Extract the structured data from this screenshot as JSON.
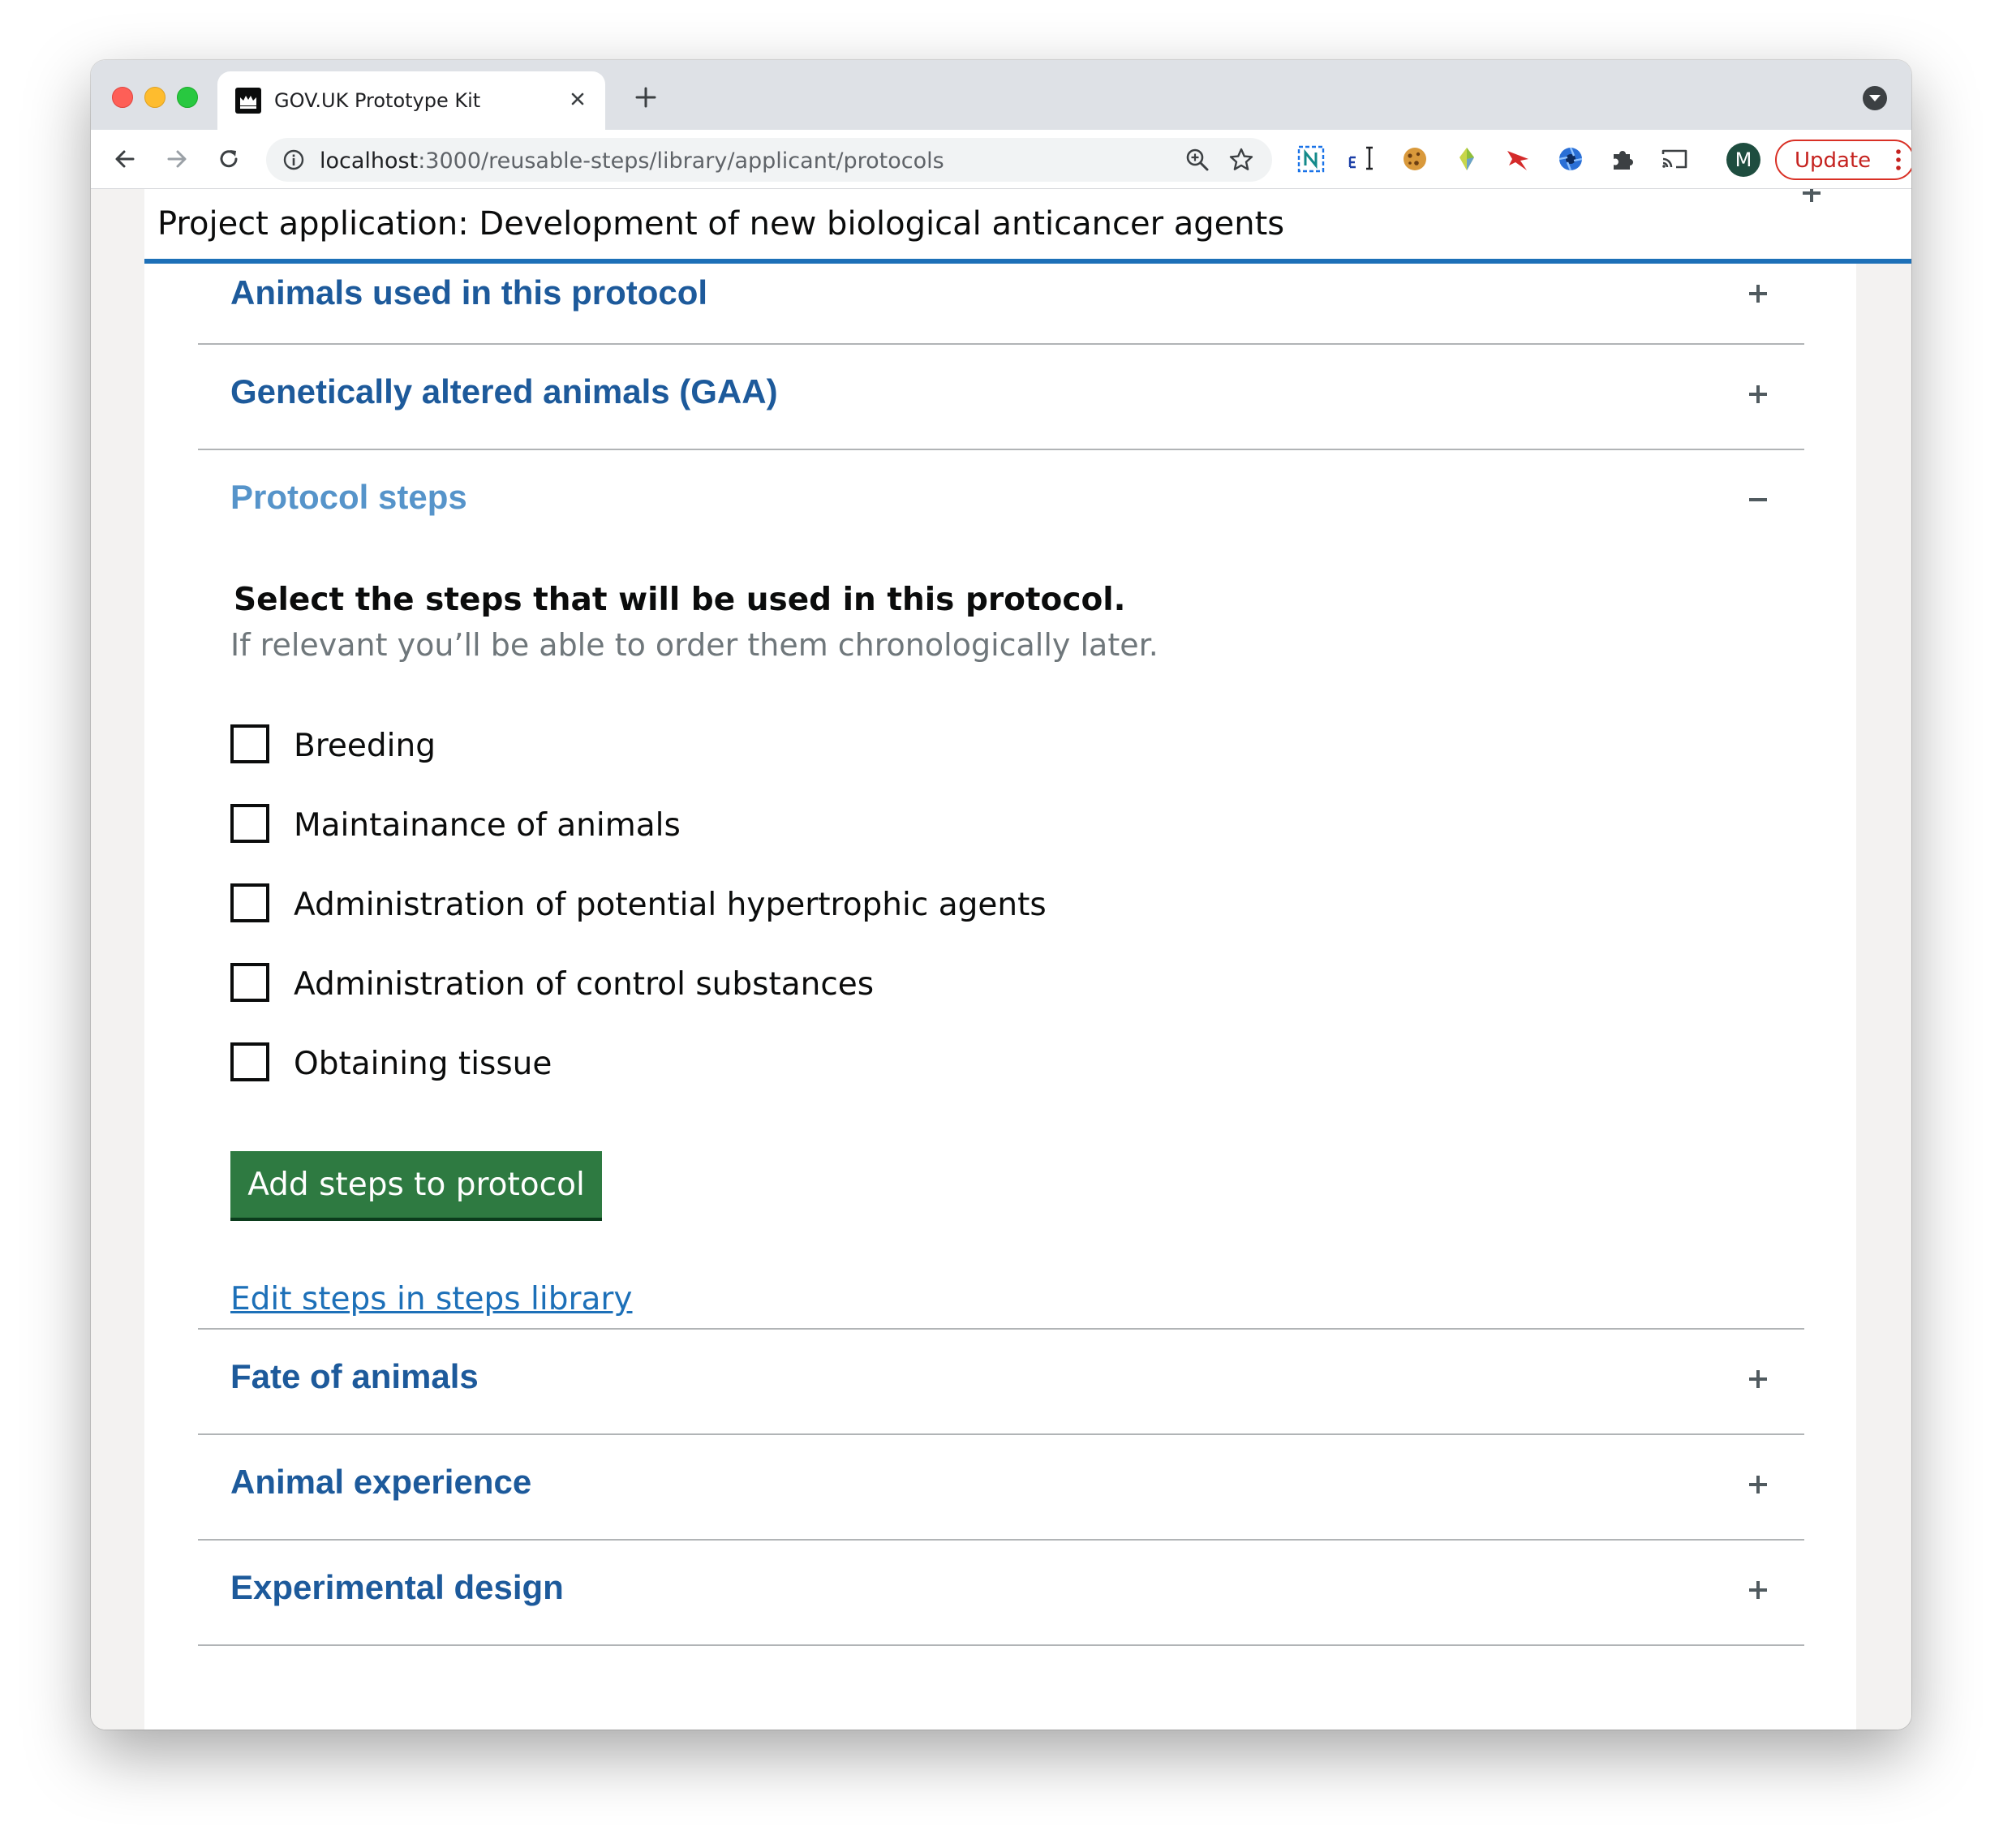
{
  "browser": {
    "tab_title": "GOV.UK Prototype Kit",
    "url_host": "localhost",
    "url_path": ":3000/reusable-steps/library/applicant/protocols",
    "avatar_letter": "M",
    "update_label": "Update"
  },
  "page": {
    "project_title": "Project application: Development of new biological anticancer agents",
    "sections": [
      {
        "heading": "Animals used in this protocol",
        "state": "collapsed"
      },
      {
        "heading": "Genetically altered animals (GAA)",
        "state": "collapsed"
      },
      {
        "heading": "Protocol steps",
        "state": "expanded"
      },
      {
        "heading": "Fate of animals",
        "state": "collapsed"
      },
      {
        "heading": "Animal experience",
        "state": "collapsed"
      },
      {
        "heading": "Experimental design",
        "state": "collapsed"
      }
    ],
    "protocol_steps": {
      "legend": "Select the steps that will be used in this protocol.",
      "hint": "If relevant you’ll be able to order them chronologically later.",
      "options": [
        {
          "label": "Breeding",
          "checked": false
        },
        {
          "label": "Maintainance of animals",
          "checked": false
        },
        {
          "label": "Administration of potential hypertrophic agents",
          "checked": false
        },
        {
          "label": "Administration of control substances",
          "checked": false
        },
        {
          "label": "Obtaining tissue",
          "checked": false
        }
      ],
      "submit_label": "Add steps to protocol",
      "library_link": "Edit steps in steps library"
    }
  },
  "colors": {
    "heading_link": "#1d5a9b",
    "heading_active": "#5694ca",
    "header_rule": "#1d70b8",
    "button_green": "#2e7a41",
    "hint_grey": "#6f777b"
  }
}
